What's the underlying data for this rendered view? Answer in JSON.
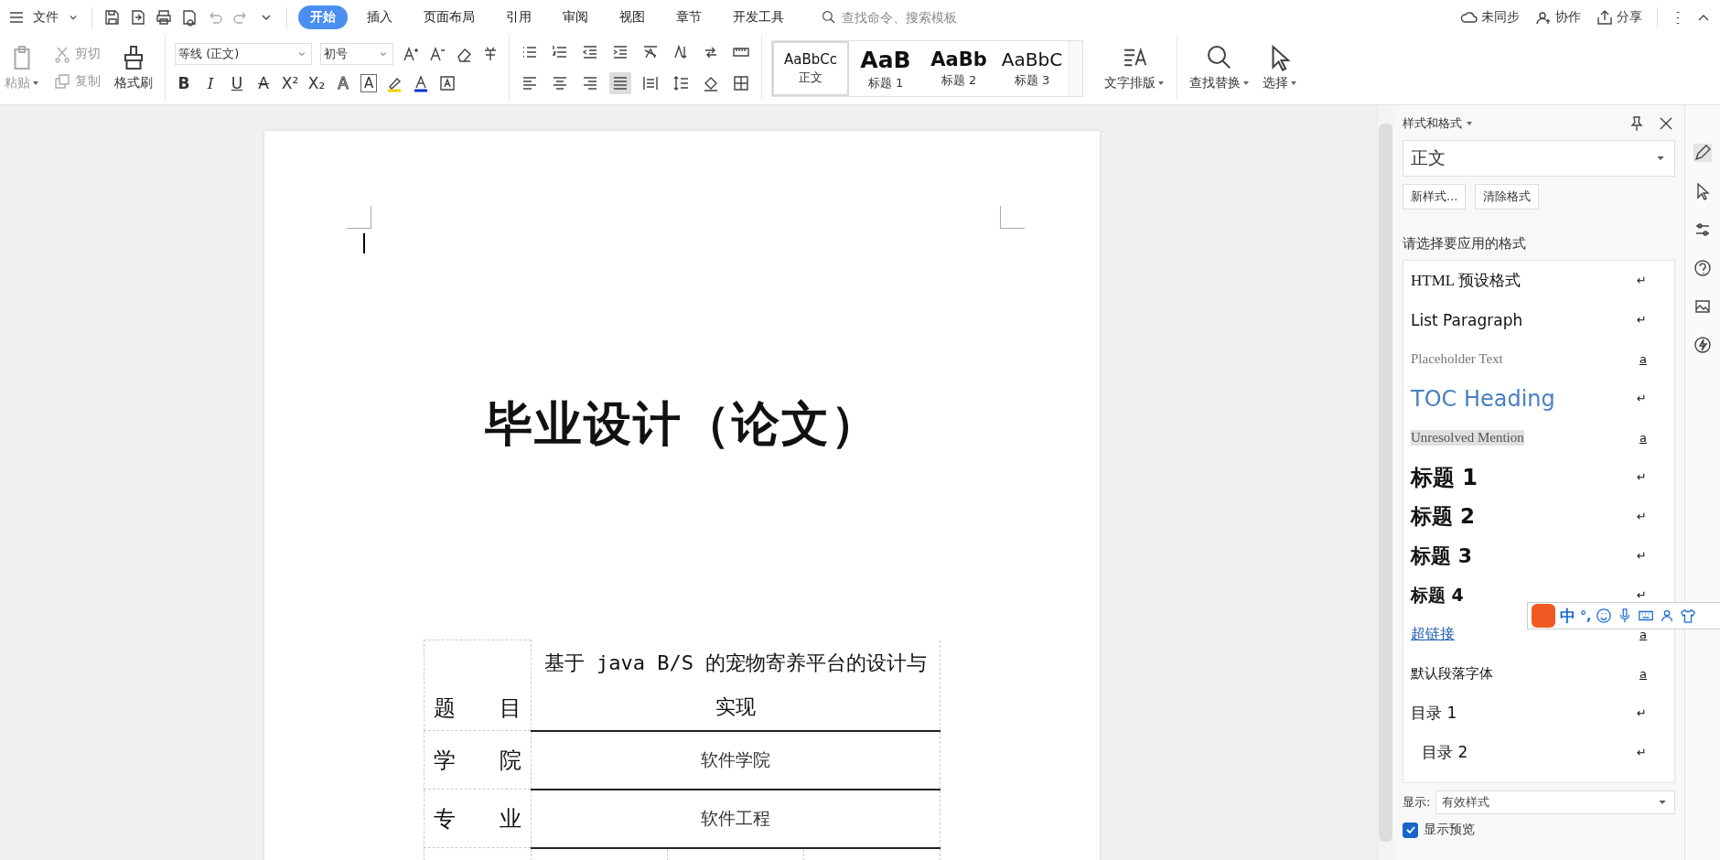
{
  "menu": {
    "file": "文件",
    "tabs": [
      {
        "label": "开始",
        "selected": true
      },
      {
        "label": "插入",
        "selected": false
      },
      {
        "label": "页面布局",
        "selected": false
      },
      {
        "label": "引用",
        "selected": false
      },
      {
        "label": "审阅",
        "selected": false
      },
      {
        "label": "视图",
        "selected": false
      },
      {
        "label": "章节",
        "selected": false
      },
      {
        "label": "开发工具",
        "selected": false
      }
    ],
    "search": {
      "placeholder": "查找命令、搜索模板"
    },
    "actions": [
      {
        "kind": "sync",
        "label": "未同步"
      },
      {
        "kind": "collab",
        "label": "协作"
      },
      {
        "kind": "share",
        "label": "分享"
      }
    ]
  },
  "ribbon": {
    "paste": "粘贴",
    "cut": "剪切",
    "copy": "复制",
    "format_painter": "格式刷",
    "font": "等线 (正文)",
    "size": "初号",
    "format_buttons": [
      "B",
      "I",
      "U",
      "A",
      "X²",
      "X₂",
      "A",
      "A"
    ],
    "styles": [
      {
        "preview": "AaBbCc",
        "name": "正文",
        "selected": true
      },
      {
        "preview": "AaB",
        "name": "标题 1",
        "selected": false
      },
      {
        "preview": "AaBb",
        "name": "标题 2",
        "selected": false
      },
      {
        "preview": "AaBbC",
        "name": "标题 3",
        "selected": false
      }
    ],
    "text_layout": "文字排版",
    "find_replace": "查找替换",
    "select": "选择"
  },
  "document": {
    "title": "毕业设计（论文）",
    "table": {
      "rows": [
        {
          "label": "题 目",
          "value": "基于 java B/S 的宠物寄养平台的设计与实现"
        },
        {
          "label": "学 院",
          "value": "软件学院"
        },
        {
          "label": "专 业",
          "value": "软件工程"
        }
      ]
    }
  },
  "panel": {
    "title": "样式和格式",
    "current": "正文",
    "new_style": "新样式...",
    "clear_format": "清除格式",
    "prompt": "请选择要应用的格式",
    "styles": [
      {
        "kind": "preformatted",
        "name": "HTML  预设格式",
        "mark": "↵"
      },
      {
        "kind": "list",
        "name": "List Paragraph",
        "mark": "↵"
      },
      {
        "kind": "placeholder",
        "name": "Placeholder Text",
        "mark": "a"
      },
      {
        "kind": "toc-heading",
        "name": "TOC Heading",
        "mark": "↵"
      },
      {
        "kind": "mention",
        "name": "Unresolved Mention",
        "mark": "a"
      },
      {
        "kind": "heading1",
        "name": "标题  1",
        "mark": "↵"
      },
      {
        "kind": "heading2",
        "name": "标题  2",
        "mark": "↵"
      },
      {
        "kind": "heading3",
        "name": "标题  3",
        "mark": "↵"
      },
      {
        "kind": "heading4",
        "name": "标题  4",
        "mark": "↵"
      },
      {
        "kind": "hyperlink",
        "name": "超链接",
        "mark": "a"
      },
      {
        "kind": "default-font",
        "name": "默认段落字体",
        "mark": "a"
      },
      {
        "kind": "toc1",
        "name": "目录  1",
        "mark": "↵"
      },
      {
        "kind": "toc2",
        "name": "目录  2",
        "mark": "↵"
      }
    ],
    "show_label": "显示:",
    "show_value": "有效样式",
    "preview": {
      "label": "显示预览",
      "checked": true
    }
  },
  "ime": {
    "mode": "中",
    "punct": "°,"
  }
}
